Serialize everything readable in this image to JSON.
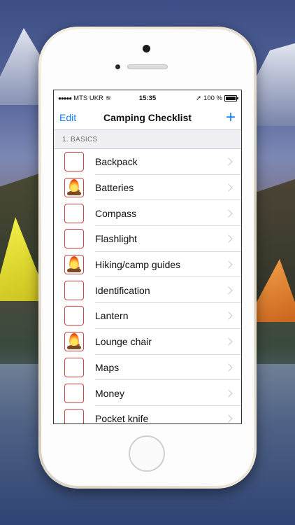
{
  "statusbar": {
    "carrier": "MTS UKR",
    "time": "15:35",
    "battery": "100 %"
  },
  "navbar": {
    "edit_label": "Edit",
    "title": "Camping Checklist",
    "add_label": "+"
  },
  "section": {
    "title": "1. BASICS"
  },
  "items": [
    {
      "label": "Backpack",
      "icon": "empty"
    },
    {
      "label": "Batteries",
      "icon": "campfire-icon"
    },
    {
      "label": "Compass",
      "icon": "empty"
    },
    {
      "label": "Flashlight",
      "icon": "empty"
    },
    {
      "label": "Hiking/camp guides",
      "icon": "campfire-icon"
    },
    {
      "label": "Identification",
      "icon": "empty"
    },
    {
      "label": "Lantern",
      "icon": "empty"
    },
    {
      "label": "Lounge chair",
      "icon": "campfire-icon"
    },
    {
      "label": "Maps",
      "icon": "empty"
    },
    {
      "label": "Money",
      "icon": "empty"
    },
    {
      "label": "Pocket knife",
      "icon": "empty"
    }
  ],
  "colors": {
    "accent": "#157efb",
    "thumb_border": "#cc4444"
  }
}
